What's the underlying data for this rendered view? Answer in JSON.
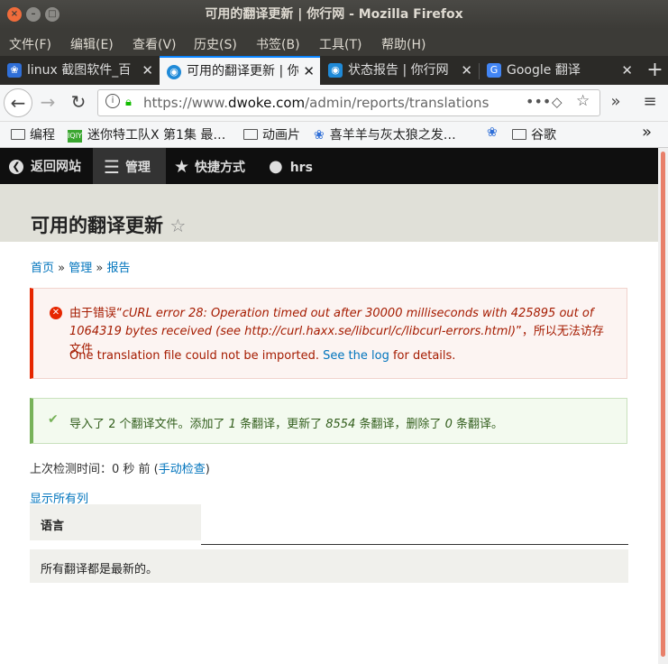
{
  "window": {
    "title": "可用的翻译更新 | 你行网 - Mozilla Firefox"
  },
  "menu": [
    "文件(F)",
    "编辑(E)",
    "查看(V)",
    "历史(S)",
    "书签(B)",
    "工具(T)",
    "帮助(H)"
  ],
  "tabs": [
    {
      "label": "linux 截图软件_百",
      "icon": "baidu-paw-icon",
      "active": false
    },
    {
      "label": "可用的翻译更新 | 你",
      "icon": "drupal-icon",
      "active": true
    },
    {
      "label": "状态报告 | 你行网",
      "icon": "drupal-icon",
      "active": false
    },
    {
      "label": "Google 翻译",
      "icon": "google-translate-icon",
      "active": false
    }
  ],
  "url": {
    "prefix": "https://www.",
    "domain": "dwoke.com",
    "path": "/admin/reports/translations"
  },
  "bookmarks": [
    {
      "label": "编程",
      "type": "folder"
    },
    {
      "label": "迷你特工队X 第1集 最…",
      "type": "site"
    },
    {
      "label": "动画片",
      "type": "folder"
    },
    {
      "label": "喜羊羊与灰太狼之发…",
      "type": "baidu"
    },
    {
      "label": "",
      "type": "baidu"
    },
    {
      "label": "谷歌",
      "type": "folder"
    }
  ],
  "admin_toolbar": {
    "back": "返回网站",
    "manage": "管理",
    "shortcuts": "快捷方式",
    "user": "hrs"
  },
  "page": {
    "title": "可用的翻译更新",
    "breadcrumb": [
      "首页",
      "管理",
      "报告"
    ],
    "error": {
      "line1_prefix": "由于错误“",
      "line1_detail": "cURL error 28: Operation timed out after 30000 milliseconds with 425895 out of 1064319 bytes received (see http://curl.haxx.se/libcurl/c/libcurl-errors.html)",
      "line1_suffix": "”，所以无法访存文件",
      "line2_prefix": "One translation file could not be imported. ",
      "line2_link": "See the log",
      "line2_suffix": " for details."
    },
    "status": {
      "p1": "导入了 2 个翻译文件。添加了 ",
      "added": "1",
      "p2": " 条翻译，更新了 ",
      "updated": "8554",
      "p3": " 条翻译，删除了 ",
      "deleted": "0",
      "p4": " 条翻译。"
    },
    "last_check_prefix": "上次检测时间：0 秒 前 (",
    "last_check_link": "手动检查",
    "last_check_suffix": ")",
    "show_all_columns": "显示所有列",
    "table": {
      "header": "语言",
      "empty_message": "所有翻译都是最新的。"
    }
  },
  "colors": {
    "error": "#e62600",
    "ok": "#77b259",
    "link": "#0074bd",
    "tab_active_line": "#0a84ff"
  }
}
